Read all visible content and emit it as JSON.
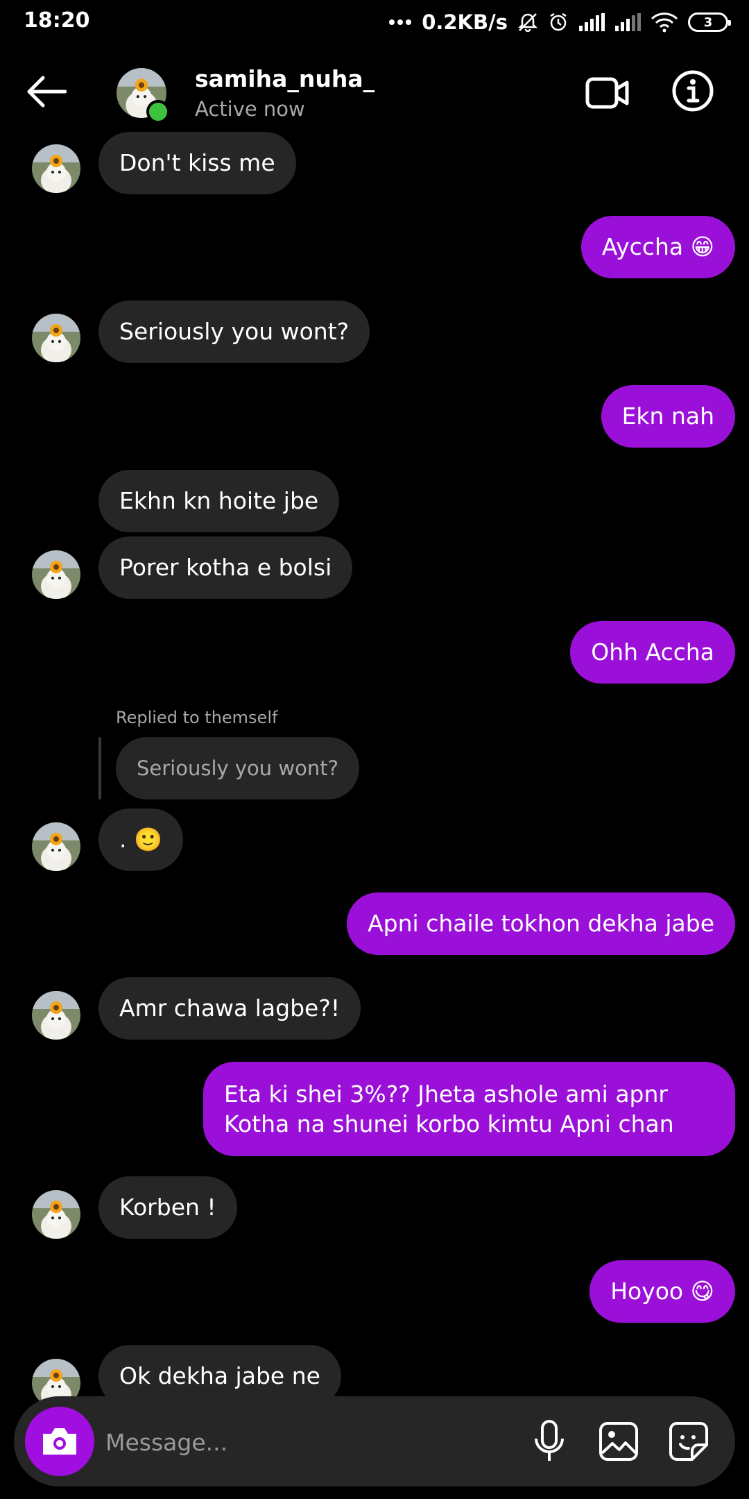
{
  "status_bar": {
    "time": "18:20",
    "network_speed": "0.2KB/s",
    "battery_level": "3"
  },
  "header": {
    "username": "samiha_nuha_",
    "status": "Active now"
  },
  "messages": [
    {
      "text": "Don't kiss me"
    },
    {
      "text": "Ayccha 😁"
    },
    {
      "text": "Seriously you wont?"
    },
    {
      "text": "Ekn nah"
    },
    {
      "text": "Ekhn kn hoite jbe"
    },
    {
      "text": "Porer kotha e bolsi"
    },
    {
      "text": "Ohh Accha"
    },
    {
      "text": ". 🙂"
    },
    {
      "text": "Apni chaile tokhon dekha jabe"
    },
    {
      "text": "Amr chawa lagbe?!"
    },
    {
      "text": "Eta ki shei 3%?? Jheta ashole ami apnr Kotha na shunei korbo kimtu Apni chan"
    },
    {
      "text": "Korben !"
    },
    {
      "text": "Hoyoo 😋"
    },
    {
      "text": "Ok dekha jabe ne"
    }
  ],
  "reply": {
    "label": "Replied to themself",
    "quoted_text": "Seriously you wont?"
  },
  "composer": {
    "placeholder": "Message..."
  },
  "colors": {
    "background": "#000000",
    "incoming_bubble": "#262626",
    "outgoing_bubble": "#9b10d8",
    "online_dot": "#3fc33f"
  }
}
